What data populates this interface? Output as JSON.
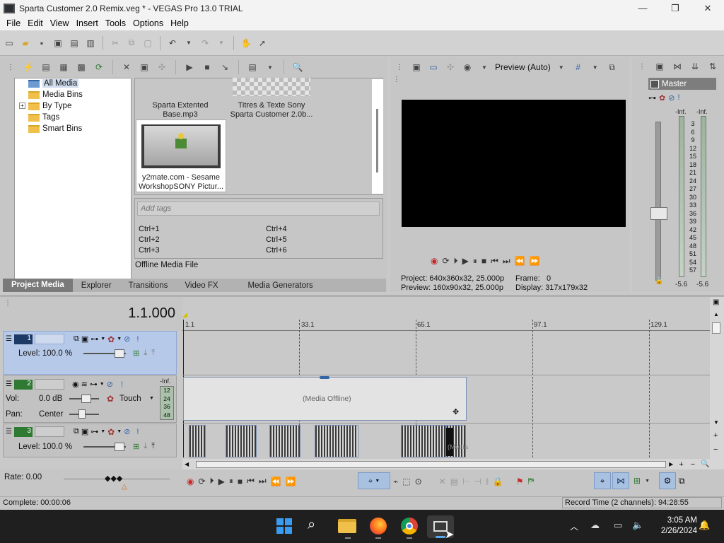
{
  "window": {
    "title": "Sparta Customer 2.0 Remix.veg * - VEGAS Pro 13.0 TRIAL",
    "minimize": "—",
    "maximize": "❐",
    "close": "✕"
  },
  "menu": [
    "File",
    "Edit",
    "View",
    "Insert",
    "Tools",
    "Options",
    "Help"
  ],
  "media_tree": {
    "items": [
      "All Media",
      "Media Bins",
      "By Type",
      "Tags",
      "Smart Bins"
    ],
    "expander": "+"
  },
  "media_files": [
    {
      "caption_line1": "Sparta Extented",
      "caption_line2": "Base.mp3"
    },
    {
      "caption_line1": "Titres & Texte Sony",
      "caption_line2": "Sparta Customer 2.0b..."
    },
    {
      "caption_line1": "y2mate.com - Sesame",
      "caption_line2": "WorkshopSONY Pictur..."
    }
  ],
  "tags": {
    "placeholder": "Add tags",
    "shortcuts": [
      "Ctrl+1",
      "Ctrl+2",
      "Ctrl+3",
      "Ctrl+4",
      "Ctrl+5",
      "Ctrl+6"
    ]
  },
  "media_status": "Offline Media File",
  "window_tabs": [
    "Project Media",
    "Explorer",
    "Transitions",
    "Video FX",
    "Media Generators"
  ],
  "preview": {
    "mode": "Preview (Auto)",
    "project_label": "Project:",
    "project_value": "640x360x32, 25.000p",
    "preview_label": "Preview:",
    "preview_value": "160x90x32, 25.000p",
    "frame_label": "Frame:",
    "frame_value": "0",
    "display_label": "Display:",
    "display_value": "317x179x32"
  },
  "mixer": {
    "label": "Master",
    "peak_left": "-Inf.",
    "peak_right": "-Inf.",
    "scale": [
      "3",
      "6",
      "9",
      "12",
      "15",
      "18",
      "21",
      "24",
      "27",
      "30",
      "33",
      "36",
      "39",
      "42",
      "45",
      "48",
      "51",
      "54",
      "57"
    ],
    "level_left": "-5.6",
    "level_right": "-5.6"
  },
  "timeline": {
    "timecode": "1.1.000",
    "ruler": [
      "1.1",
      "33.1",
      "65.1",
      "97.1",
      "129.1"
    ],
    "clip_label": "(Media Offline)",
    "clip_label_2": "(Media"
  },
  "tracks": [
    {
      "number": "1",
      "level_label": "Level:",
      "level_value": "100.0 %"
    },
    {
      "number": "2",
      "vol_label": "Vol:",
      "vol_value": "0.0 dB",
      "pan_label": "Pan:",
      "pan_value": "Center",
      "mode": "Touch",
      "meter_top": "-Inf.",
      "meter_scale": [
        "12",
        "24",
        "36",
        "48"
      ]
    },
    {
      "number": "3",
      "level_label": "Level:",
      "level_value": "100.0 %"
    }
  ],
  "rate": {
    "label": "Rate:",
    "value": "0.00"
  },
  "status": {
    "complete": "Complete: 00:00:06",
    "record_time": "Record Time (2 channels): 94:28:55"
  },
  "taskbar": {
    "time": "3:05 AM",
    "date": "2/26/2024"
  },
  "colors": {
    "track_selected": "#b7c9e8",
    "track_header": "#c2c2c2",
    "timeline_bg": "#c9c9c9",
    "clip_fill": "#e3e3e3",
    "accent_blue": "#3465a4",
    "video_track_icon": "#1d3a66",
    "audio_track_icon": "#2e7a32"
  }
}
